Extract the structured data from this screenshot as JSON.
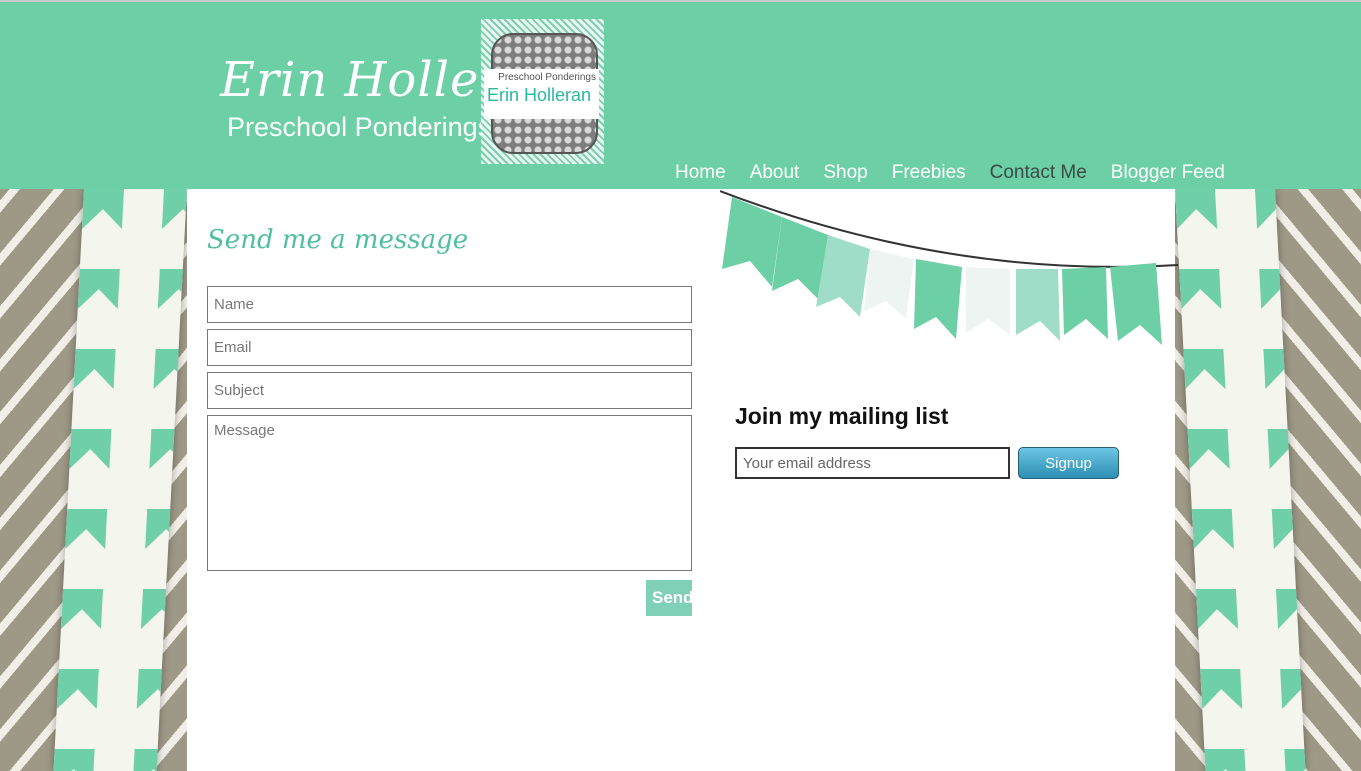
{
  "header": {
    "brand_name": "Erin Holleran",
    "brand_tagline": "Preschool Ponderings",
    "logo_small_text": "Preschool Ponderings",
    "logo_big_text": "Erin Holleran",
    "nav": [
      "Home",
      "About",
      "Shop",
      "Freebies",
      "Contact Me",
      "Blogger Feed"
    ],
    "active_nav": "Contact Me"
  },
  "contact_form": {
    "title": "Send me a message",
    "name_placeholder": "Name",
    "email_placeholder": "Email",
    "subject_placeholder": "Subject",
    "message_placeholder": "Message",
    "send_label": "Send"
  },
  "mailing_list": {
    "title": "Join my mailing list",
    "email_placeholder": "Your email address",
    "signup_label": "Signup"
  },
  "colors": {
    "header_green": "#6dcfa5",
    "accent_teal": "#4fbfa0",
    "signup_blue": "#3aa2c6"
  }
}
